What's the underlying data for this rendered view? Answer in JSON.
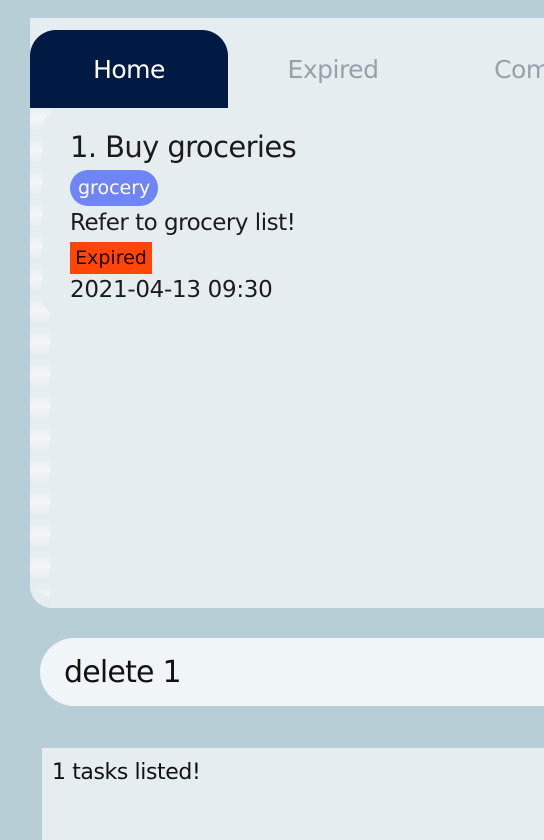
{
  "tabs": [
    {
      "label": "Home",
      "active": true
    },
    {
      "label": "Expired",
      "active": false
    },
    {
      "label": "Completed",
      "active": false
    }
  ],
  "task_list": {
    "items": [
      {
        "title": "1. Buy groceries",
        "tag": "grocery",
        "description": "Refer to grocery list!",
        "status_badge": "Expired",
        "deadline": "2021-04-13 09:30"
      }
    ]
  },
  "command_box": {
    "value": "delete 1"
  },
  "result_display": {
    "text": "1 tasks listed!"
  },
  "colors": {
    "background": "#b8ced6",
    "panel": "#e6edf1",
    "active_tab": "#001a44",
    "tag": "#6f84f5",
    "expired_badge": "#ff4606"
  }
}
